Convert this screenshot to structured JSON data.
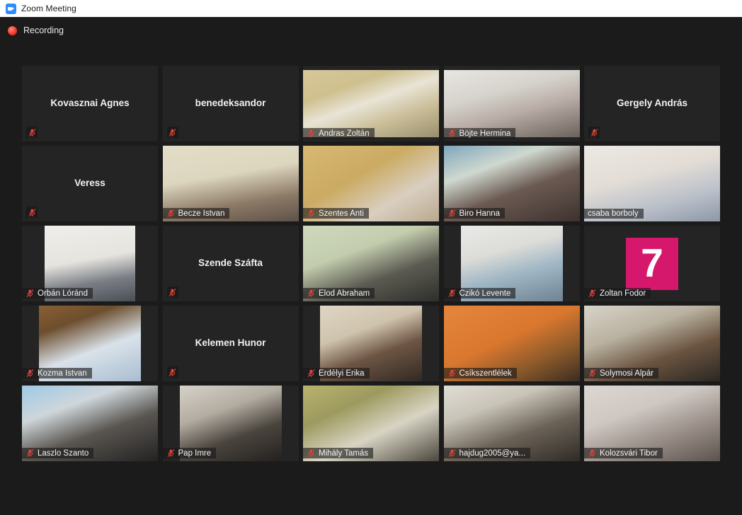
{
  "window": {
    "title": "Zoom Meeting",
    "app_icon": "zoom-camera-icon"
  },
  "status": {
    "recording_label": "Recording",
    "recording_icon": "record-dot-icon",
    "recording_color": "#f03c2e"
  },
  "colors": {
    "background": "#1b1b1b",
    "tile": "#242424",
    "active_speaker_border": "#c6f53e",
    "mute_icon": "#e8453c",
    "logo_avatar": "#d6186c"
  },
  "icons": {
    "mic_muted": "microphone-muted-icon"
  },
  "gallery": {
    "columns": 5,
    "rows": 5,
    "participants": [
      {
        "name": "Kovasznai Agnes",
        "video": false,
        "muted": true,
        "speaking": false,
        "avatar": null,
        "bg": ""
      },
      {
        "name": "benedeksandor",
        "video": false,
        "muted": true,
        "speaking": false,
        "avatar": null,
        "bg": ""
      },
      {
        "name": "Andras Zoltán",
        "video": true,
        "muted": true,
        "speaking": false,
        "avatar": null,
        "bg": "linear-gradient(160deg,#d8c79a 0%,#cfc08f 28%,#e8e4d6 48%,#cbbf9a 70%,#9a8f6d 100%)"
      },
      {
        "name": "Böjte Hermina",
        "video": true,
        "muted": true,
        "speaking": false,
        "avatar": null,
        "bg": "linear-gradient(165deg,#e8e6e2 0%,#d6d3cd 35%,#b9ada6 60%,#6a625c 100%)"
      },
      {
        "name": "Gergely András",
        "video": false,
        "muted": true,
        "speaking": false,
        "avatar": null,
        "bg": ""
      },
      {
        "name": "Veress",
        "video": false,
        "muted": true,
        "speaking": false,
        "avatar": null,
        "bg": ""
      },
      {
        "name": "Becze Istvan",
        "video": true,
        "muted": true,
        "speaking": false,
        "avatar": null,
        "bg": "linear-gradient(170deg,#e3ddc8 0%,#ddd6bf 40%,#8c7a67 72%,#5d5148 100%)"
      },
      {
        "name": "Szentes Anti",
        "video": true,
        "muted": true,
        "speaking": false,
        "avatar": null,
        "bg": "linear-gradient(150deg,#d8b972 0%,#cbab63 40%,#d9cfc0 70%,#b9a88f 100%)"
      },
      {
        "name": "Biro Hanna",
        "video": true,
        "muted": true,
        "speaking": false,
        "avatar": null,
        "bg": "linear-gradient(160deg,#7fa6bd 0%,#cfd8cf 30%,#6b5a52 58%,#3d322e 100%)"
      },
      {
        "name": "csaba borboly",
        "video": true,
        "muted": false,
        "speaking": true,
        "avatar": null,
        "bg": "linear-gradient(165deg,#ece8e3 0%,#e3ddd6 40%,#b9bfc9 72%,#8d97a6 100%)"
      },
      {
        "name": "Orbán Lóránd",
        "video": true,
        "muted": true,
        "speaking": false,
        "avatar": null,
        "bg": "linear-gradient(170deg,#efeeea 0%,#e6e4df 45%,#7a7e84 72%,#4a4f56 100%)"
      },
      {
        "name": "Szende Száfta",
        "video": false,
        "muted": true,
        "speaking": false,
        "avatar": null,
        "bg": ""
      },
      {
        "name": "Elod Abraham",
        "video": true,
        "muted": true,
        "speaking": false,
        "avatar": null,
        "bg": "linear-gradient(160deg,#cfd8bc 0%,#c3cdae 35%,#5c5b52 65%,#2e2e2c 100%)"
      },
      {
        "name": "Czikó Levente",
        "video": true,
        "muted": true,
        "speaking": false,
        "avatar": null,
        "bg": "linear-gradient(165deg,#e9e9e7 0%,#dcdcd8 35%,#9fb6c4 62%,#6f8392 100%)"
      },
      {
        "name": "Zoltan Fodor",
        "video": false,
        "muted": true,
        "speaking": false,
        "avatar": "7",
        "bg": ""
      },
      {
        "name": "Kozma Istvan",
        "video": true,
        "muted": true,
        "speaking": false,
        "avatar": null,
        "bg": "linear-gradient(160deg,#8a5f33 0%,#6d4e2e 25%,#d9e2ea 58%,#a9bdd0 100%)"
      },
      {
        "name": "Kelemen Hunor",
        "video": false,
        "muted": true,
        "speaking": false,
        "avatar": null,
        "bg": ""
      },
      {
        "name": "Erdélyi Erika",
        "video": true,
        "muted": true,
        "speaking": false,
        "avatar": null,
        "bg": "linear-gradient(160deg,#ded6c6 0%,#cfc3ad 35%,#6d5544 62%,#312923 100%)"
      },
      {
        "name": "Csíkszentlélek",
        "video": true,
        "muted": true,
        "speaking": false,
        "avatar": null,
        "bg": "linear-gradient(155deg,#e6853c 0%,#d9772f 45%,#8c5a2a 72%,#3a2d23 100%)"
      },
      {
        "name": "Solymosi Alpár",
        "video": true,
        "muted": true,
        "speaking": false,
        "avatar": null,
        "bg": "linear-gradient(160deg,#d8d4c9 0%,#b9b1a0 35%,#6a5440 65%,#2b2723 100%)"
      },
      {
        "name": "Laszlo Szanto",
        "video": true,
        "muted": true,
        "speaking": false,
        "avatar": null,
        "bg": "linear-gradient(160deg,#9ec9e6 0%,#cfd6da 30%,#595550 60%,#232222 100%)"
      },
      {
        "name": "Pap Imre",
        "video": true,
        "muted": true,
        "speaking": false,
        "avatar": null,
        "bg": "linear-gradient(160deg,#d7d2c9 0%,#b2aca1 35%,#4a443e 65%,#23211e 100%)"
      },
      {
        "name": "Mihály Tamás",
        "video": true,
        "muted": true,
        "speaking": false,
        "avatar": null,
        "bg": "linear-gradient(155deg,#b8b36e 0%,#9d9a5f 30%,#d8d4c4 60%,#4b463c 100%)"
      },
      {
        "name": "hajdug2005@ya...",
        "video": true,
        "muted": true,
        "speaking": false,
        "avatar": null,
        "bg": "linear-gradient(160deg,#e0ddd4 0%,#c9c4b8 30%,#6b6257 62%,#2f2b26 100%)"
      },
      {
        "name": "Kolozsvári Tibor",
        "video": true,
        "muted": true,
        "speaking": false,
        "avatar": null,
        "bg": "linear-gradient(160deg,#ddd7d2 0%,#cec7c2 35%,#9a8f89 65%,#5c534e 100%)"
      }
    ]
  }
}
